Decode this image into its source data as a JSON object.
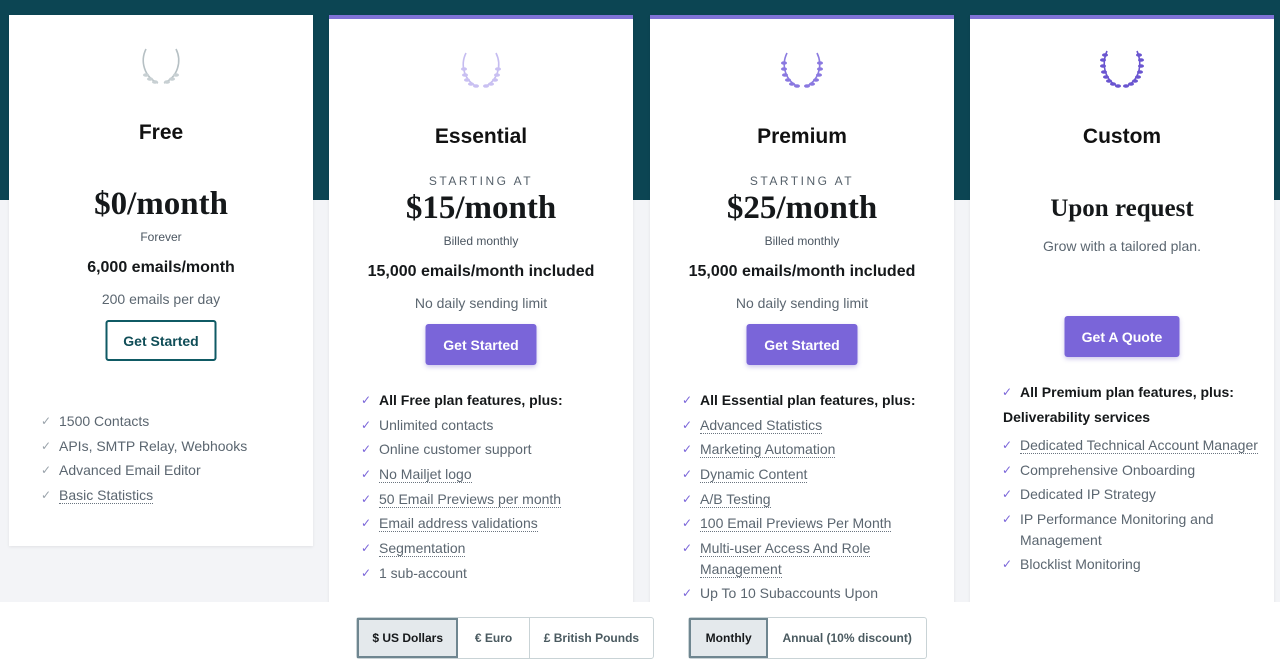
{
  "plans": {
    "free": {
      "name": "Free",
      "price": "$0/month",
      "billing": "Forever",
      "quota": "6,000 emails/month",
      "subquota": "200 emails per day",
      "button": "Get Started",
      "features": [
        "1500 Contacts",
        "APIs, SMTP Relay, Webhooks",
        "Advanced Email Editor",
        "Basic Statistics"
      ]
    },
    "essential": {
      "name": "Essential",
      "starting": "STARTING AT",
      "price": "$15/month",
      "billing": "Billed monthly",
      "quota": "15,000 emails/month included",
      "subquota": "No daily sending limit",
      "button": "Get Started",
      "features_head": "All Free plan features, plus:",
      "features": [
        "Unlimited contacts",
        "Online customer support",
        "No Mailjet logo",
        "50 Email Previews per month",
        "Email address validations",
        "Segmentation",
        "1 sub-account"
      ]
    },
    "premium": {
      "name": "Premium",
      "starting": "STARTING AT",
      "price": "$25/month",
      "billing": "Billed monthly",
      "quota": "15,000 emails/month included",
      "subquota": "No daily sending limit",
      "button": "Get Started",
      "features_head": "All Essential plan features, plus:",
      "features": [
        "Advanced Statistics",
        "Marketing Automation",
        "Dynamic Content",
        "A/B Testing",
        "100 Email Previews Per Month",
        "Multi-user Access And Role Management",
        "Up To 10 Subaccounts Upon"
      ]
    },
    "custom": {
      "name": "Custom",
      "price": "Upon request",
      "tagline": "Grow with a tailored plan.",
      "button": "Get A Quote",
      "features_head": "All Premium plan features, plus:",
      "deliverability_head": "Deliverability services",
      "features": [
        "Dedicated Technical Account Manager",
        "Comprehensive Onboarding",
        "Dedicated IP Strategy",
        "IP Performance Monitoring and Management",
        "Blocklist Monitoring"
      ]
    }
  },
  "currency": {
    "options": [
      "$ US Dollars",
      "€ Euro",
      "£ British Pounds"
    ],
    "selected": "$ US Dollars"
  },
  "billing_period": {
    "options": [
      "Monthly",
      "Annual (10% discount)"
    ],
    "selected": "Monthly"
  },
  "colors": {
    "accent": "#7a65d9",
    "header_band": "#0c4553"
  }
}
